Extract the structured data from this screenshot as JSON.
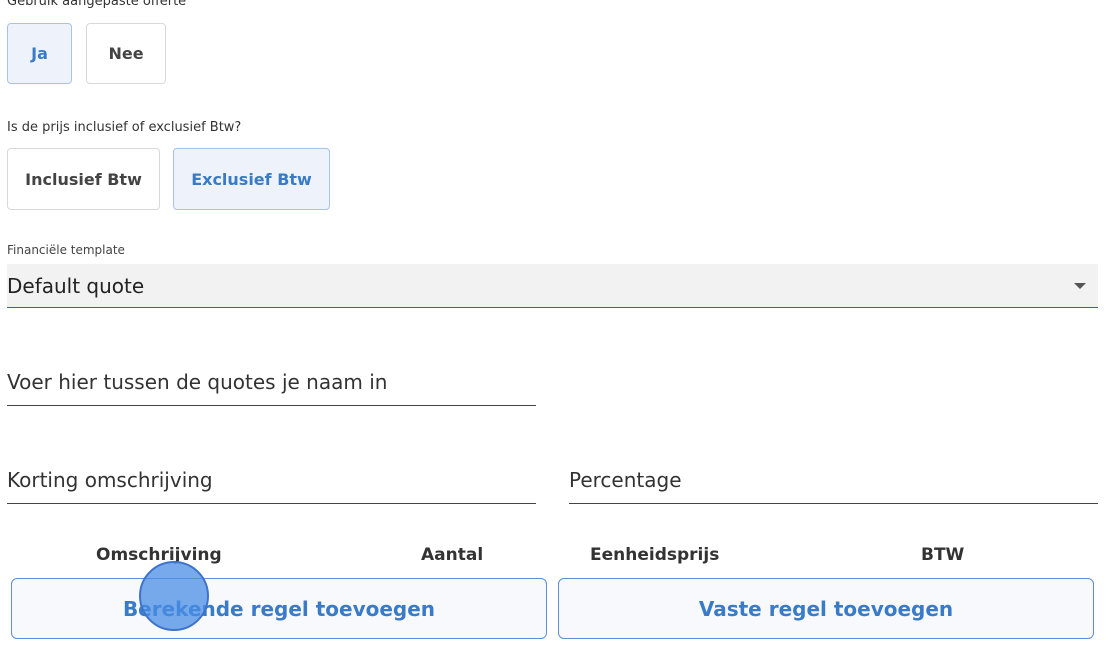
{
  "custom_quote": {
    "label": "Gebruik aangepaste offerte",
    "options": [
      "Ja",
      "Nee"
    ],
    "selected": "Ja"
  },
  "vat": {
    "label": "Is de prijs inclusief of exclusief Btw?",
    "options": [
      "Inclusief Btw",
      "Exclusief Btw"
    ],
    "selected": "Exclusief Btw"
  },
  "template": {
    "label": "Financiële template",
    "value": "Default quote"
  },
  "name_field": {
    "placeholder": "Voer hier tussen de quotes je naam in"
  },
  "discount": {
    "description_placeholder": "Korting omschrijving",
    "percentage_placeholder": "Percentage"
  },
  "lines_table": {
    "columns": [
      "Omschrijving",
      "Aantal",
      "Eenheidsprijs",
      "BTW"
    ]
  },
  "actions": {
    "add_calculated": "Berekende regel toevoegen",
    "add_fixed": "Vaste regel toevoegen"
  },
  "colors": {
    "accent": "#3a7bc8",
    "selected_bg": "#eef3fb",
    "click_indicator": "#4a8de6"
  }
}
